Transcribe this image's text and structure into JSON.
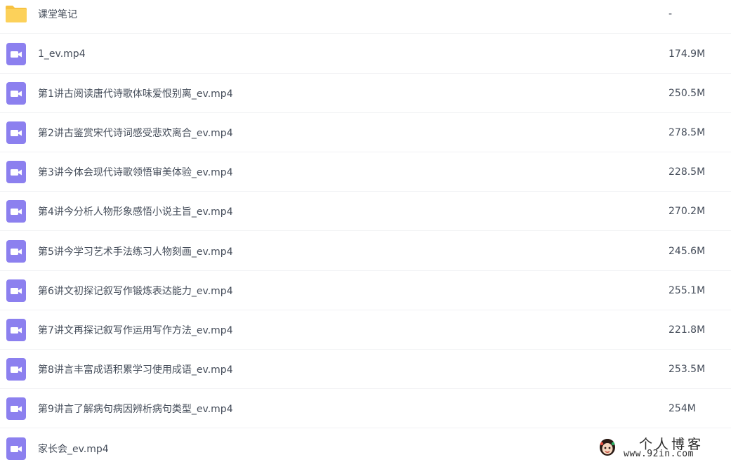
{
  "file_list": {
    "rows": [
      {
        "type": "folder",
        "icon": "folder-icon",
        "name": "课堂笔记",
        "size": "-"
      },
      {
        "type": "video",
        "icon": "video-file-icon",
        "name": "1_ev.mp4",
        "size": "174.9M"
      },
      {
        "type": "video",
        "icon": "video-file-icon",
        "name": "第1讲古阅读唐代诗歌体味爱恨别离_ev.mp4",
        "size": "250.5M"
      },
      {
        "type": "video",
        "icon": "video-file-icon",
        "name": "第2讲古鉴赏宋代诗词感受悲欢离合_ev.mp4",
        "size": "278.5M"
      },
      {
        "type": "video",
        "icon": "video-file-icon",
        "name": "第3讲今体会现代诗歌领悟审美体验_ev.mp4",
        "size": "228.5M"
      },
      {
        "type": "video",
        "icon": "video-file-icon",
        "name": "第4讲今分析人物形象感悟小说主旨_ev.mp4",
        "size": "270.2M"
      },
      {
        "type": "video",
        "icon": "video-file-icon",
        "name": "第5讲今学习艺术手法练习人物刻画_ev.mp4",
        "size": "245.6M"
      },
      {
        "type": "video",
        "icon": "video-file-icon",
        "name": "第6讲文初探记叙写作锻炼表达能力_ev.mp4",
        "size": "255.1M"
      },
      {
        "type": "video",
        "icon": "video-file-icon",
        "name": "第7讲文再探记叙写作运用写作方法_ev.mp4",
        "size": "221.8M"
      },
      {
        "type": "video",
        "icon": "video-file-icon",
        "name": "第8讲言丰富成语积累学习使用成语_ev.mp4",
        "size": "253.5M"
      },
      {
        "type": "video",
        "icon": "video-file-icon",
        "name": "第9讲言了解病句病因辨析病句类型_ev.mp4",
        "size": "254M"
      },
      {
        "type": "video",
        "icon": "video-file-icon",
        "name": "家长会_ev.mp4",
        "size": ""
      }
    ]
  },
  "watermark": {
    "title": "个人博客",
    "url": "www.92in.com"
  },
  "colors": {
    "folder": "#fcd15a",
    "folder_tab": "#f7c242",
    "video": "#8c80ef",
    "text": "#454d5a",
    "divider": "#f1f2f4"
  }
}
